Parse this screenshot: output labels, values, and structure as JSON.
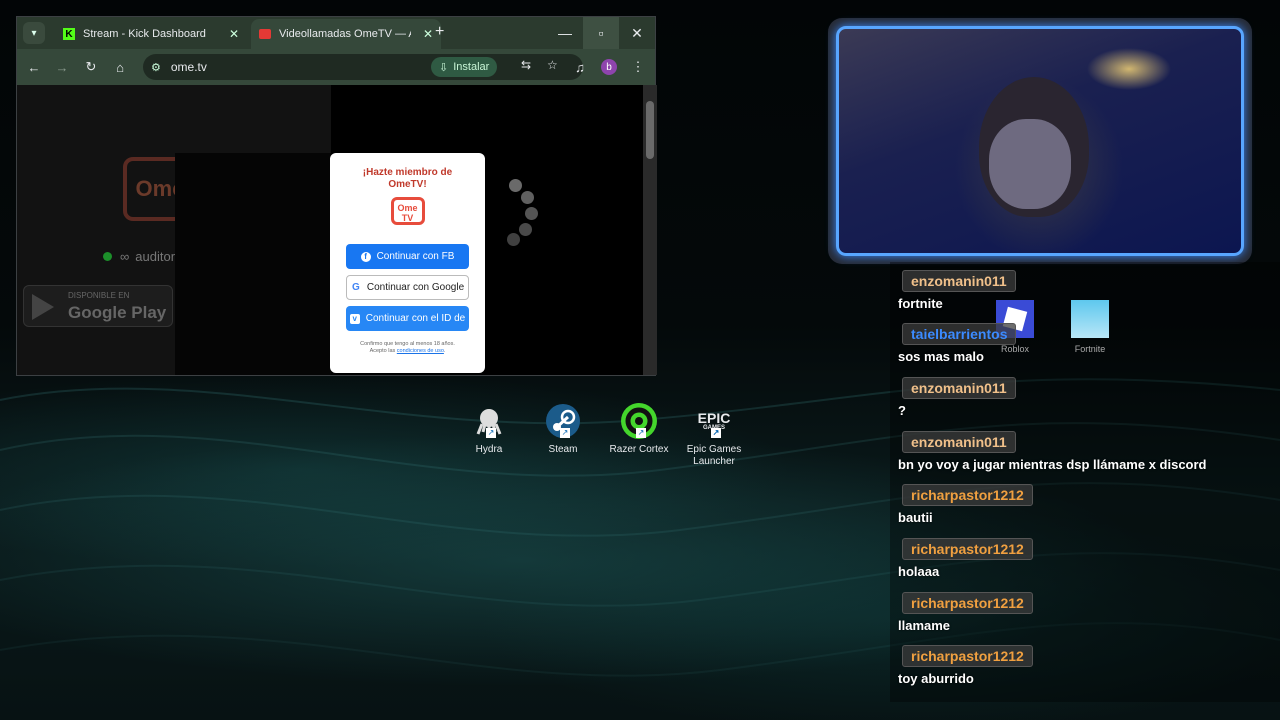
{
  "browser": {
    "tabs": [
      {
        "label": "Stream - Kick Dashboard",
        "active": false
      },
      {
        "label": "Videollamadas OmeTV — Alter",
        "active": true
      }
    ],
    "url": "ome.tv",
    "install_label": "Instalar",
    "page": {
      "auditor_text": "auditor",
      "google_play_small": "DISPONIBLE EN",
      "google_play_big": "Google Play",
      "modal": {
        "title": "¡Hazte miembro de OmeTV!",
        "logo_top": "Ome",
        "logo_bottom": "TV",
        "fb_button": "Continuar con  FB",
        "google_button": "Continuar con  Google",
        "vk_button": "Continuar con  el ID de",
        "fine_print": "Confirmo que tengo al menos 18 años.",
        "fine_accept": "Acepto las",
        "fine_link": "condiciones de uso"
      }
    }
  },
  "desktop_icons": [
    {
      "label": "Hydra"
    },
    {
      "label": "Steam"
    },
    {
      "label": "Razer Cortex"
    },
    {
      "label": "Epic Games Launcher"
    }
  ],
  "game_icons": [
    {
      "label": "Roblox"
    },
    {
      "label": "Fortnite"
    }
  ],
  "chat": [
    {
      "user": "enzomanin011",
      "text": "fortnite",
      "color": "#f0c08a"
    },
    {
      "user": "taielbarrientos",
      "text": "sos mas malo",
      "color": "#3b8bff"
    },
    {
      "user": "enzomanin011",
      "text": "?",
      "color": "#f0c08a"
    },
    {
      "user": "enzomanin011",
      "text": "bn yo voy a jugar mientras dsp llámame x discord",
      "color": "#f0c08a"
    },
    {
      "user": "richarpastor1212",
      "text": "bautii",
      "color": "#f0a040"
    },
    {
      "user": "richarpastor1212",
      "text": "holaaa",
      "color": "#f0a040"
    },
    {
      "user": "richarpastor1212",
      "text": "llamame",
      "color": "#f0a040"
    },
    {
      "user": "richarpastor1212",
      "text": "toy aburrido",
      "color": "#f0a040"
    }
  ]
}
